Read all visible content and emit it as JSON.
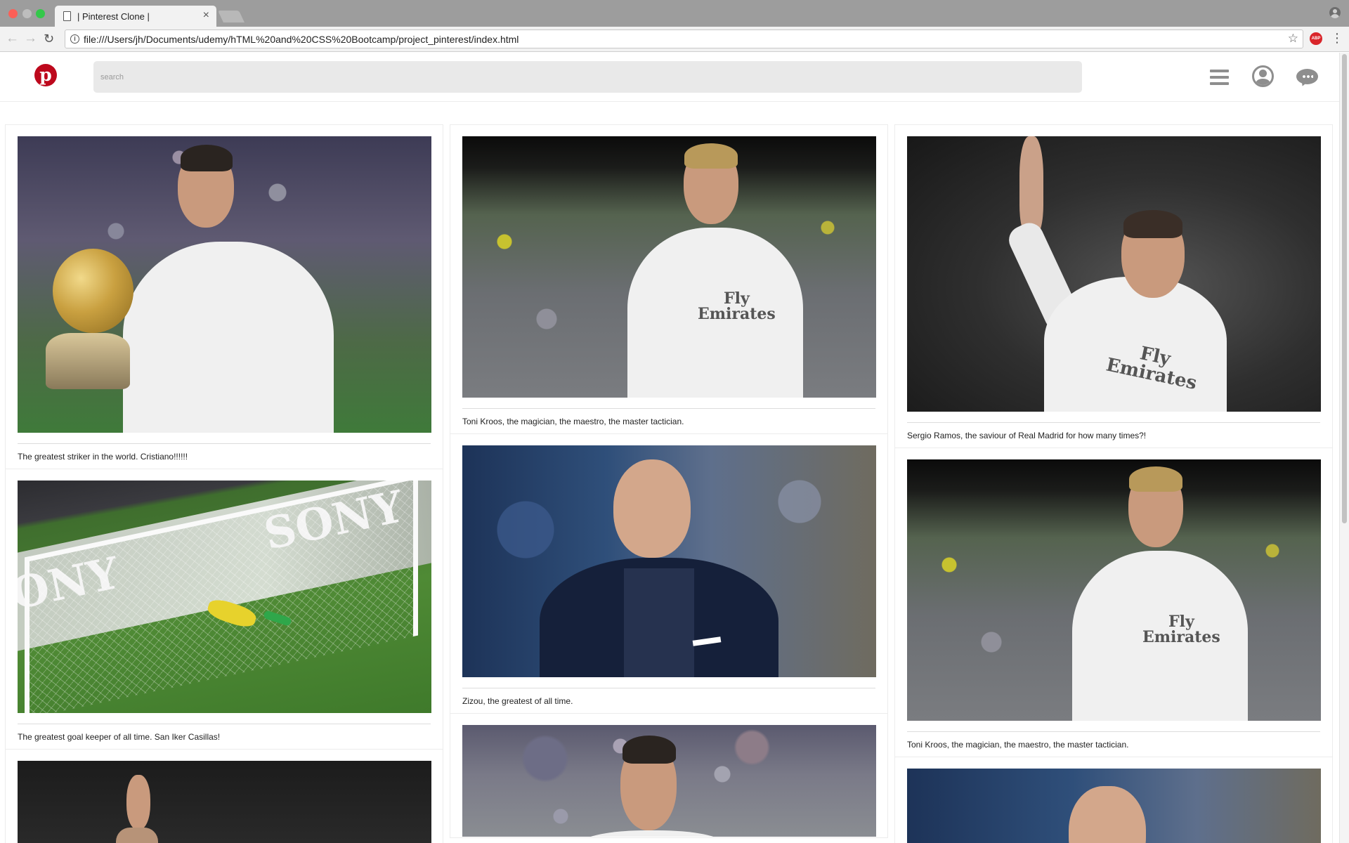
{
  "browser": {
    "tab_title": "| Pinterest Clone |",
    "url": "file:///Users/jh/Documents/udemy/hTML%20and%20CSS%20Bootcamp/project_pinterest/index.html",
    "extension_label": "ABP"
  },
  "header": {
    "logo_letter": "p",
    "search_placeholder": "search"
  },
  "columns": [
    {
      "pins": [
        {
          "caption": "The greatest striker in the world. Cristiano!!!!!!",
          "photo": "cristiano-ballon-dor"
        },
        {
          "caption": "The greatest goal keeper of all time. San Iker Casillas!",
          "photo": "casillas-diving-save"
        },
        {
          "caption": "",
          "photo": "sergio-ramos-pointing"
        }
      ]
    },
    {
      "pins": [
        {
          "caption": "Toni Kroos, the magician, the maestro, the master tactician.",
          "photo": "toni-kroos-running"
        },
        {
          "caption": "Zizou, the greatest of all time.",
          "photo": "zidane-smiling"
        },
        {
          "caption": "",
          "photo": "cristiano-smiling"
        }
      ]
    },
    {
      "pins": [
        {
          "caption": "Sergio Ramos, the saviour of Real Madrid for how many times?!",
          "photo": "sergio-ramos-pointing"
        },
        {
          "caption": "Toni Kroos, the magician, the maestro, the master tactician.",
          "photo": "toni-kroos-running"
        },
        {
          "caption": "",
          "photo": "zidane-portrait"
        }
      ]
    }
  ],
  "colors": {
    "pinterest_red": "#bd081c",
    "search_bg": "#e9e9e9",
    "icon_gray": "#8e8e8e"
  }
}
